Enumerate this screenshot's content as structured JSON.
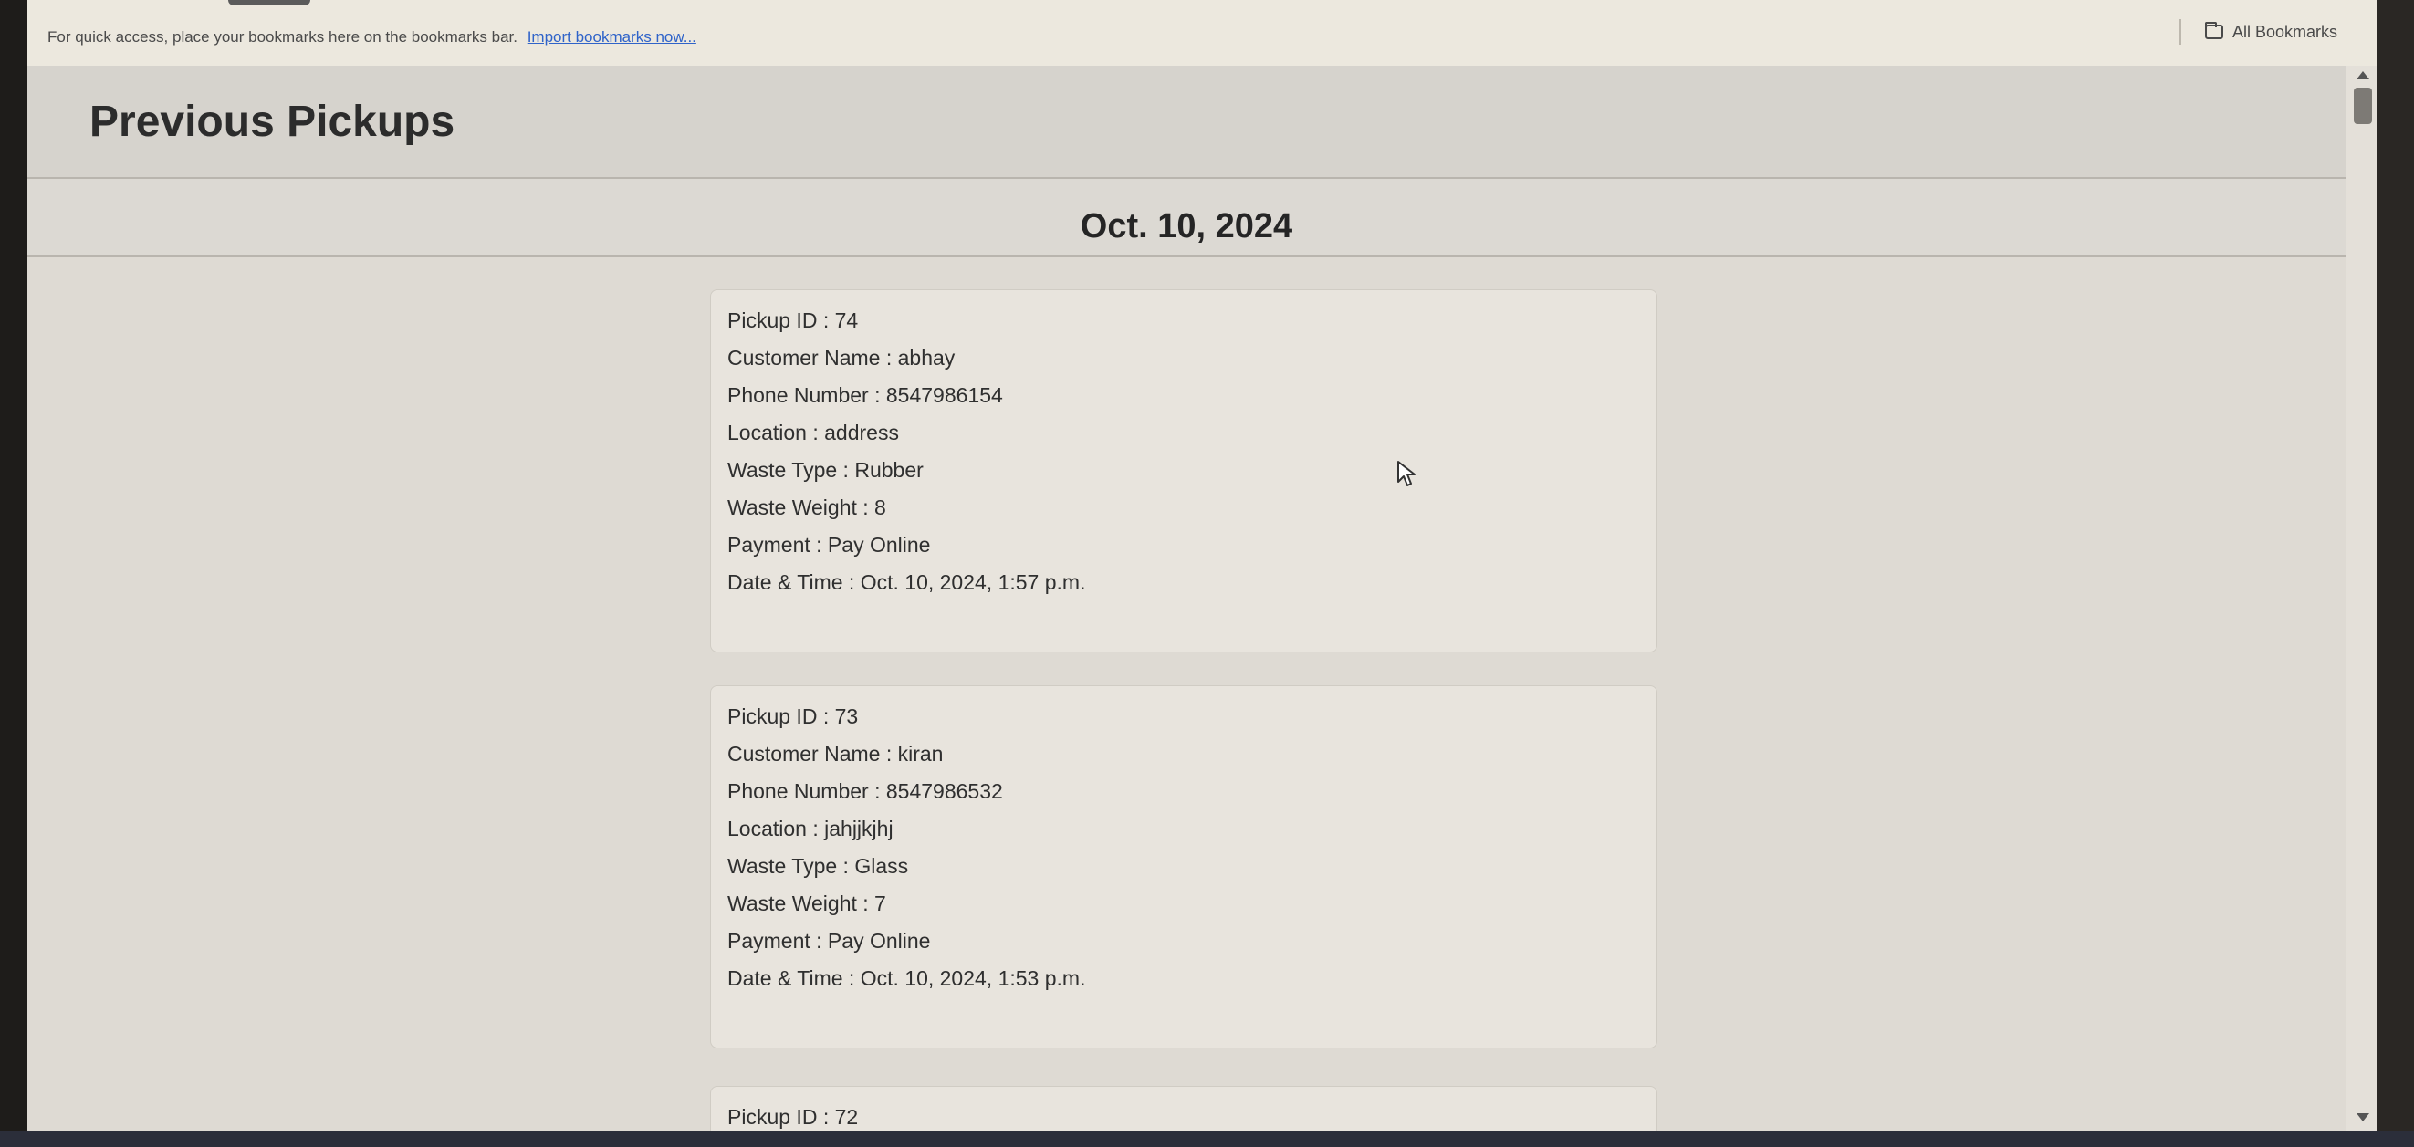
{
  "bookmarks_bar": {
    "hint": "For quick access, place your bookmarks here on the bookmarks bar.",
    "import_link": "Import bookmarks now...",
    "all_bookmarks": "All Bookmarks"
  },
  "page": {
    "title": "Previous Pickups",
    "date_heading": "Oct. 10, 2024"
  },
  "pickups": [
    {
      "pickup_id": "Pickup ID : 74",
      "customer_name": "Customer Name : abhay",
      "phone": "Phone Number : 8547986154",
      "location": "Location : address",
      "waste_type": "Waste Type : Rubber",
      "waste_weight": "Waste Weight : 8",
      "payment": "Payment : Pay Online",
      "datetime": "Date & Time : Oct. 10, 2024, 1:57 p.m."
    },
    {
      "pickup_id": "Pickup ID : 73",
      "customer_name": "Customer Name : kiran",
      "phone": "Phone Number : 8547986532",
      "location": "Location : jahjjkjhj",
      "waste_type": "Waste Type : Glass",
      "waste_weight": "Waste Weight : 7",
      "payment": "Payment : Pay Online",
      "datetime": "Date & Time : Oct. 10, 2024, 1:53 p.m."
    },
    {
      "pickup_id": "Pickup ID : 72"
    }
  ],
  "icons": {
    "folder": "folder-icon",
    "cursor": "mouse-cursor-icon"
  }
}
